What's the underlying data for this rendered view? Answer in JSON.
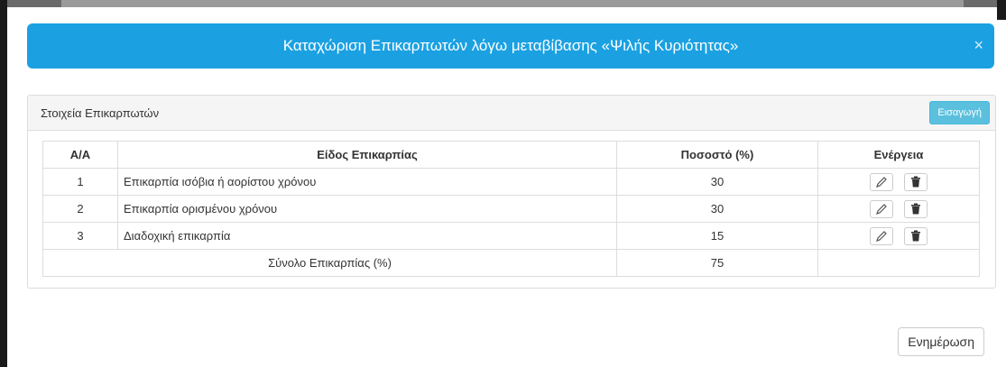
{
  "modal": {
    "title": "Καταχώριση Επικαρπωτών λόγω μεταβίβασης «Ψιλής Κυριότητας»",
    "close_symbol": "×"
  },
  "panel": {
    "title": "Στοιχεία Επικαρπωτών",
    "insert_label": "Εισαγωγή"
  },
  "table": {
    "headers": [
      "Α/Α",
      "Είδος Επικαρπίας",
      "Ποσοστό (%)",
      "Ενέργεια"
    ],
    "rows": [
      {
        "num": "1",
        "type": "Επικαρπία ισόβια ή αορίστου χρόνου",
        "percent": "30"
      },
      {
        "num": "2",
        "type": "Επικαρπία ορισμένου χρόνου",
        "percent": "30"
      },
      {
        "num": "3",
        "type": "Διαδοχική επικαρπία",
        "percent": "15"
      }
    ],
    "total_label": "Σύνολο Επικαρπίας (%)",
    "total_value": "75"
  },
  "footer": {
    "update_label": "Ενημέρωση"
  },
  "icons": {
    "edit": "pencil-icon",
    "delete": "trash-icon"
  },
  "colors": {
    "header_bg": "#1ba1e2",
    "insert_button_bg": "#5bc0de"
  }
}
